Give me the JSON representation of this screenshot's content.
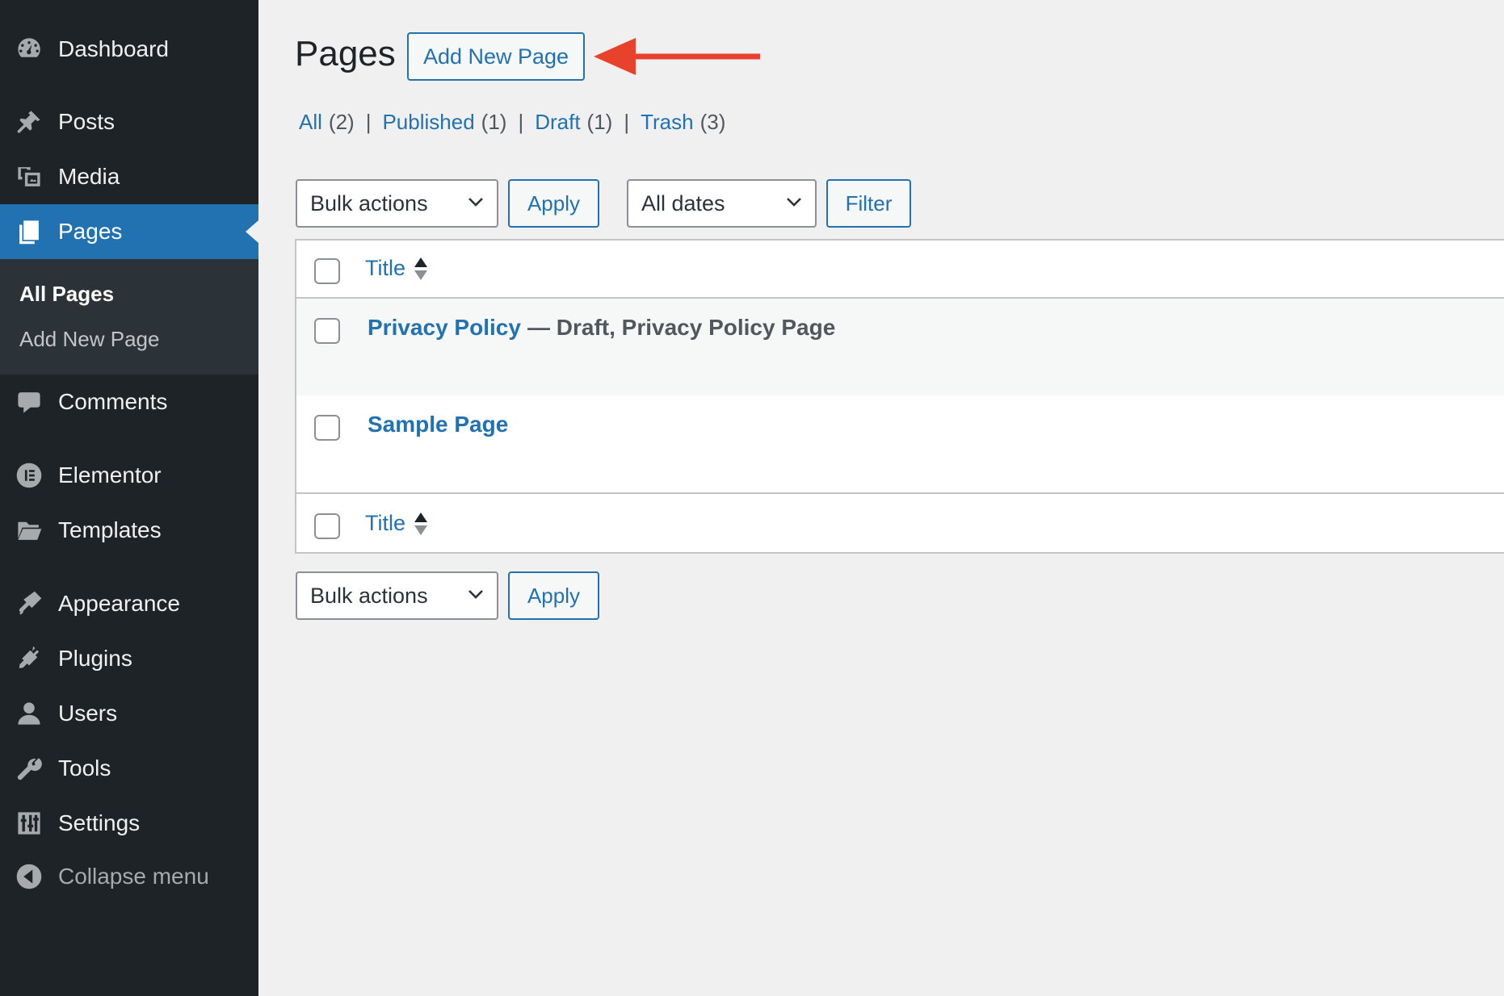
{
  "sidebar": {
    "items": [
      {
        "label": "Dashboard",
        "icon": "dashboard-icon"
      },
      {
        "label": "Posts",
        "icon": "pin-icon"
      },
      {
        "label": "Media",
        "icon": "media-icon"
      },
      {
        "label": "Pages",
        "icon": "pages-icon",
        "current": true
      },
      {
        "label": "Comments",
        "icon": "comment-icon"
      },
      {
        "label": "Elementor",
        "icon": "elementor-icon"
      },
      {
        "label": "Templates",
        "icon": "folder-icon"
      },
      {
        "label": "Appearance",
        "icon": "brush-icon"
      },
      {
        "label": "Plugins",
        "icon": "plug-icon"
      },
      {
        "label": "Users",
        "icon": "user-icon"
      },
      {
        "label": "Tools",
        "icon": "wrench-icon"
      },
      {
        "label": "Settings",
        "icon": "settings-icon"
      }
    ],
    "submenu": [
      {
        "label": "All Pages",
        "active": true
      },
      {
        "label": "Add New Page"
      }
    ],
    "collapse_label": "Collapse menu"
  },
  "main": {
    "title": "Pages",
    "add_new_label": "Add New Page",
    "filters": [
      {
        "label": "All",
        "count": "(2)"
      },
      {
        "label": "Published",
        "count": "(1)"
      },
      {
        "label": "Draft",
        "count": "(1)"
      },
      {
        "label": "Trash",
        "count": "(3)"
      }
    ],
    "separator": "|",
    "bulk_actions": "Bulk actions",
    "apply_label": "Apply",
    "dates": "All dates",
    "filter_label": "Filter",
    "column_title": "Title",
    "rows": [
      {
        "title": "Privacy Policy",
        "state": "— Draft, Privacy Policy Page"
      },
      {
        "title": "Sample Page",
        "state": ""
      }
    ]
  },
  "colors": {
    "accent": "#2271b1",
    "sidebar_bg": "#1d2327",
    "annotation_arrow": "#e8412c"
  }
}
